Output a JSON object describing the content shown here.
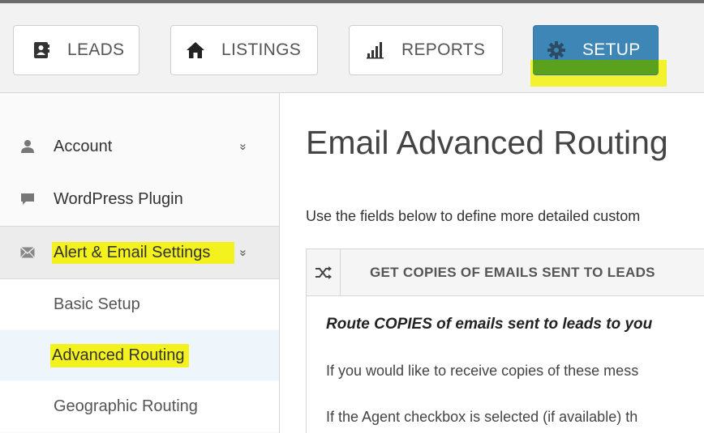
{
  "topnav": {
    "items": [
      {
        "label": "LEADS",
        "icon": "contact-card-icon"
      },
      {
        "label": "LISTINGS",
        "icon": "home-icon"
      },
      {
        "label": "REPORTS",
        "icon": "bar-chart-icon"
      },
      {
        "label": "SETUP",
        "icon": "gear-icon",
        "active": true
      }
    ],
    "active_color": "#3e86b6",
    "highlight_color": "#f4f21e"
  },
  "sidebar": {
    "items": [
      {
        "label": "Account",
        "icon": "user-icon",
        "chevron": "»"
      },
      {
        "label": "WordPress Plugin",
        "icon": "speech-bubble-icon"
      },
      {
        "label": "Alert & Email Settings",
        "icon": "envelope-icon",
        "chevron": "»",
        "expanded": true
      }
    ],
    "subitems": [
      {
        "label": "Basic Setup"
      },
      {
        "label": "Advanced Routing",
        "active": true
      },
      {
        "label": "Geographic Routing"
      }
    ]
  },
  "main": {
    "title": "Email Advanced Routing",
    "intro": "Use the fields below to define more detailed custom",
    "panel": {
      "icon": "shuffle-icon",
      "heading": "GET COPIES OF EMAILS SENT TO LEADS",
      "line1": "Route COPIES of emails sent to leads to you",
      "line2": "If you would like to receive copies of these mess",
      "line3": "If the Agent checkbox is selected (if available) th"
    }
  }
}
